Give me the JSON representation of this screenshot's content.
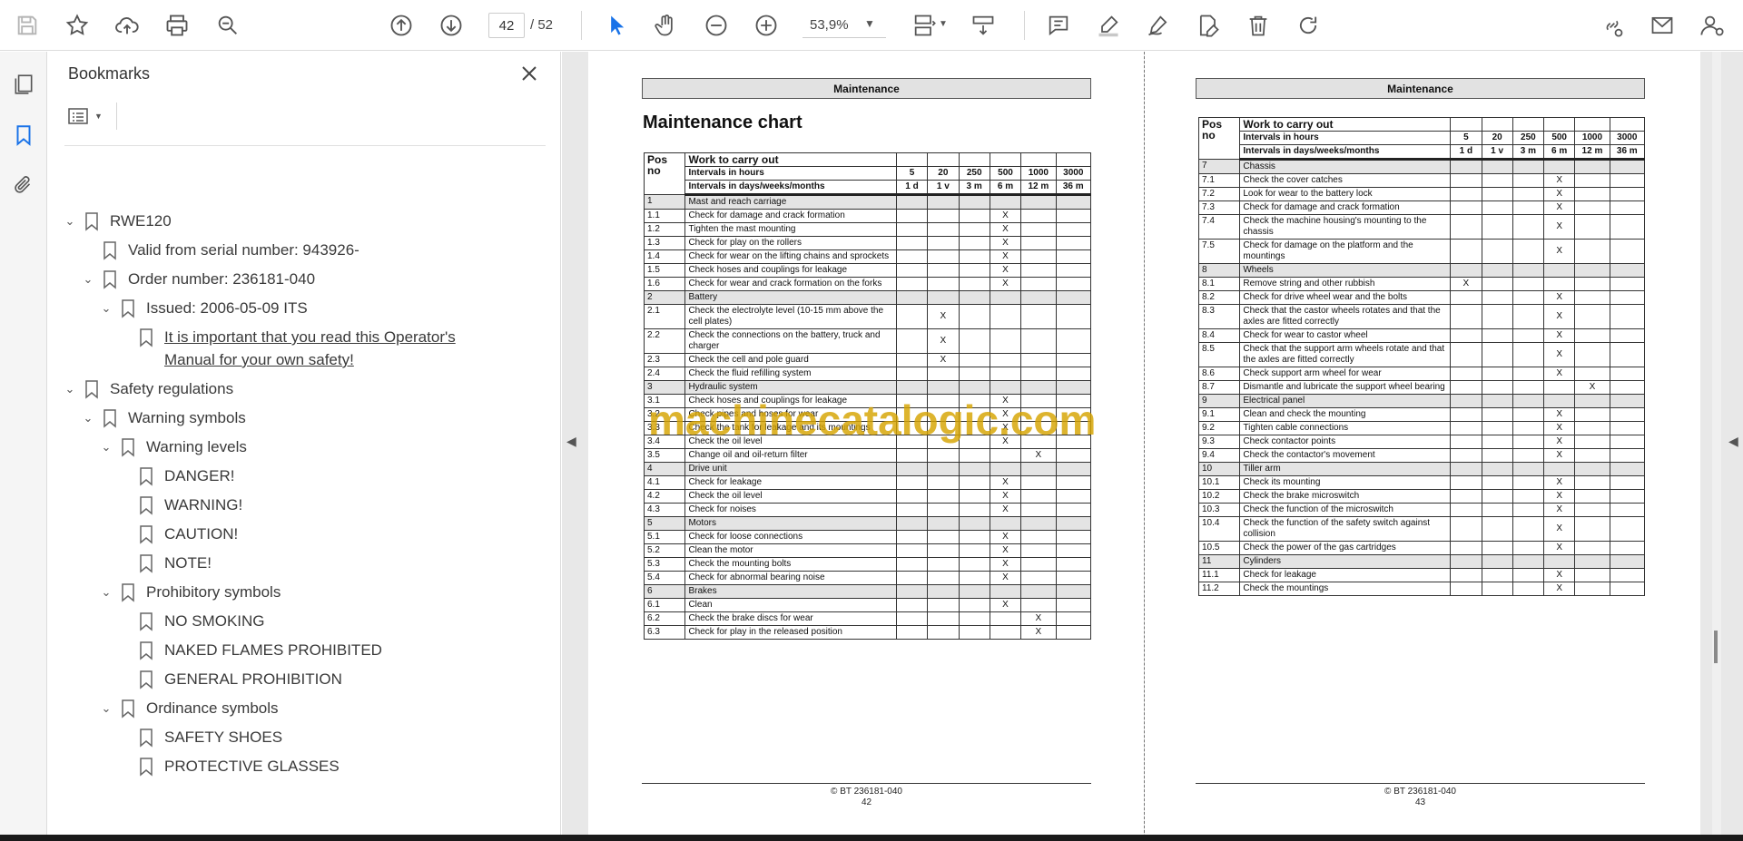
{
  "toolbar": {
    "page_current": "42",
    "page_total": "/ 52",
    "zoom": "53,9%"
  },
  "bookmarks": {
    "title": "Bookmarks",
    "items": [
      {
        "label": "RWE120"
      },
      {
        "label": "Valid from serial number: 943926-"
      },
      {
        "label": "Order number: 236181-040"
      },
      {
        "label": "Issued: 2006-05-09 ITS"
      },
      {
        "label": "It is important that you read this Operator's"
      },
      {
        "label": "Manual for your own safety!"
      },
      {
        "label": "Safety regulations"
      },
      {
        "label": "Warning symbols"
      },
      {
        "label": "Warning levels"
      },
      {
        "label": "DANGER!"
      },
      {
        "label": "WARNING!"
      },
      {
        "label": "CAUTION!"
      },
      {
        "label": "NOTE!"
      },
      {
        "label": "Prohibitory symbols"
      },
      {
        "label": "NO SMOKING"
      },
      {
        "label": "NAKED FLAMES PROHIBITED"
      },
      {
        "label": "GENERAL PROHIBITION"
      },
      {
        "label": "Ordinance symbols"
      },
      {
        "label": "SAFETY SHOES"
      },
      {
        "label": "PROTECTIVE GLASSES"
      }
    ]
  },
  "page_left": {
    "header": "Maintenance",
    "title": "Maintenance chart",
    "footer_code": "© BT 236181-040",
    "footer_page": "42",
    "table_header": {
      "pos": "Pos no",
      "work": "Work to carry out",
      "hours_label": "Intervals in hours",
      "hours": [
        "5",
        "20",
        "250",
        "500",
        "1000",
        "3000"
      ],
      "days_label": "Intervals in days/weeks/months",
      "days": [
        "1 d",
        "1 v",
        "3 m",
        "6 m",
        "12 m",
        "36 m"
      ]
    },
    "rows": [
      {
        "pos": "1",
        "text": "Mast and reach carriage",
        "section": true,
        "x": -1
      },
      {
        "pos": "1.1",
        "text": "Check for damage and crack formation",
        "x": 3
      },
      {
        "pos": "1.2",
        "text": "Tighten the mast mounting",
        "x": 3
      },
      {
        "pos": "1.3",
        "text": "Check for play on the rollers",
        "x": 3
      },
      {
        "pos": "1.4",
        "text": "Check for wear on the lifting chains and sprockets",
        "x": 3
      },
      {
        "pos": "1.5",
        "text": "Check hoses and couplings for leakage",
        "x": 3
      },
      {
        "pos": "1.6",
        "text": "Check for wear and crack formation on the forks",
        "x": 3
      },
      {
        "pos": "2",
        "text": "Battery",
        "section": true,
        "x": -1
      },
      {
        "pos": "2.1",
        "text": "Check the electrolyte level (10-15 mm above the cell plates)",
        "x": 1
      },
      {
        "pos": "2.2",
        "text": "Check the connections on the battery, truck and charger",
        "x": 1
      },
      {
        "pos": "2.3",
        "text": "Check the cell and pole guard",
        "x": 1
      },
      {
        "pos": "2.4",
        "text": "Check the fluid refilling system",
        "x": -1
      },
      {
        "pos": "3",
        "text": "Hydraulic system",
        "section": true,
        "x": -1
      },
      {
        "pos": "3.1",
        "text": "Check hoses and couplings for leakage",
        "x": 3
      },
      {
        "pos": "3.2",
        "text": "Check pipes and hoses for wear",
        "x": 3
      },
      {
        "pos": "3.3",
        "text": "Check the tank for leakage and its mountings",
        "x": 3
      },
      {
        "pos": "3.4",
        "text": "Check the oil level",
        "x": 3
      },
      {
        "pos": "3.5",
        "text": "Change oil and oil-return filter",
        "x": 4
      },
      {
        "pos": "4",
        "text": "Drive unit",
        "section": true,
        "x": -1
      },
      {
        "pos": "4.1",
        "text": "Check for leakage",
        "x": 3
      },
      {
        "pos": "4.2",
        "text": "Check the oil level",
        "x": 3
      },
      {
        "pos": "4.3",
        "text": "Check for noises",
        "x": 3
      },
      {
        "pos": "5",
        "text": "Motors",
        "section": true,
        "x": -1
      },
      {
        "pos": "5.1",
        "text": "Check for loose connections",
        "x": 3
      },
      {
        "pos": "5.2",
        "text": "Clean the motor",
        "x": 3
      },
      {
        "pos": "5.3",
        "text": "Check the mounting bolts",
        "x": 3
      },
      {
        "pos": "5.4",
        "text": "Check for abnormal bearing noise",
        "x": 3
      },
      {
        "pos": "6",
        "text": "Brakes",
        "section": true,
        "x": -1
      },
      {
        "pos": "6.1",
        "text": "Clean",
        "x": 3
      },
      {
        "pos": "6.2",
        "text": "Check the brake discs for wear",
        "x": 4
      },
      {
        "pos": "6.3",
        "text": "Check for play in the released position",
        "x": 4
      }
    ]
  },
  "page_right": {
    "header": "Maintenance",
    "footer_code": "© BT 236181-040",
    "footer_page": "43",
    "table_header": {
      "pos": "Pos no",
      "work": "Work to carry out",
      "hours_label": "Intervals in hours",
      "hours": [
        "5",
        "20",
        "250",
        "500",
        "1000",
        "3000"
      ],
      "days_label": "Intervals in days/weeks/months",
      "days": [
        "1 d",
        "1 v",
        "3 m",
        "6 m",
        "12 m",
        "36 m"
      ]
    },
    "rows": [
      {
        "pos": "7",
        "text": "Chassis",
        "section": true,
        "x": -1
      },
      {
        "pos": "7.1",
        "text": "Check the cover catches",
        "x": 3
      },
      {
        "pos": "7.2",
        "text": "Look for wear to the battery lock",
        "x": 3
      },
      {
        "pos": "7.3",
        "text": "Check for damage and crack formation",
        "x": 3
      },
      {
        "pos": "7.4",
        "text": "Check the machine housing's mounting to the chassis",
        "x": 3
      },
      {
        "pos": "7.5",
        "text": "Check for damage on the platform and the mountings",
        "x": 3
      },
      {
        "pos": "8",
        "text": "Wheels",
        "section": true,
        "x": -1
      },
      {
        "pos": "8.1",
        "text": "Remove string and other rubbish",
        "x": 0
      },
      {
        "pos": "8.2",
        "text": "Check for drive wheel wear and the bolts",
        "x": 3
      },
      {
        "pos": "8.3",
        "text": "Check that the castor wheels rotates and that the axles are fitted correctly",
        "x": 3
      },
      {
        "pos": "8.4",
        "text": "Check for wear to castor wheel",
        "x": 3
      },
      {
        "pos": "8.5",
        "text": "Check that the support arm wheels rotate and that the axles are fitted correctly",
        "x": 3
      },
      {
        "pos": "8.6",
        "text": "Check support arm wheel for wear",
        "x": 3
      },
      {
        "pos": "8.7",
        "text": "Dismantle and lubricate the support wheel bearing",
        "x": 4
      },
      {
        "pos": "9",
        "text": "Electrical panel",
        "section": true,
        "x": -1
      },
      {
        "pos": "9.1",
        "text": "Clean and check the mounting",
        "x": 3
      },
      {
        "pos": "9.2",
        "text": "Tighten cable connections",
        "x": 3
      },
      {
        "pos": "9.3",
        "text": "Check contactor points",
        "x": 3
      },
      {
        "pos": "9.4",
        "text": "Check the contactor's movement",
        "x": 3
      },
      {
        "pos": "10",
        "text": "Tiller arm",
        "section": true,
        "x": -1
      },
      {
        "pos": "10.1",
        "text": "Check its mounting",
        "x": 3
      },
      {
        "pos": "10.2",
        "text": "Check the brake microswitch",
        "x": 3
      },
      {
        "pos": "10.3",
        "text": "Check the function of the microswitch",
        "x": 3
      },
      {
        "pos": "10.4",
        "text": "Check the function of the safety switch against collision",
        "x": 3
      },
      {
        "pos": "10.5",
        "text": "Check the power of the gas cartridges",
        "x": 3
      },
      {
        "pos": "11",
        "text": "Cylinders",
        "section": true,
        "x": -1
      },
      {
        "pos": "11.1",
        "text": "Check for leakage",
        "x": 3
      },
      {
        "pos": "11.2",
        "text": "Check the mountings",
        "x": 3
      }
    ]
  },
  "watermark": "machinecatalogic.com",
  "x_mark": "X",
  "colors": {
    "accent_blue": "#1a73e8",
    "watermark": "#d6a400",
    "section_bg": "#e4e4e4"
  }
}
